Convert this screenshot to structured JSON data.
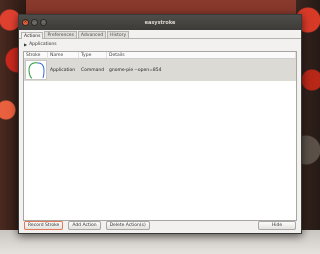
{
  "window": {
    "title": "easystroke",
    "buttons": [
      "×",
      "–",
      "□"
    ]
  },
  "tabs": [
    {
      "label": "Actions",
      "active": true
    },
    {
      "label": "Preferences",
      "active": false
    },
    {
      "label": "Advanced",
      "active": false
    },
    {
      "label": "History",
      "active": false
    }
  ],
  "expander": {
    "label": "Applications",
    "icon": "triangle-right-icon",
    "arrow_glyph": "▶"
  },
  "table": {
    "columns": [
      "Stroke",
      "Name",
      "Type",
      "Details"
    ],
    "rows": [
      {
        "stroke": "stroke-gesture-icon",
        "name": "Application",
        "type": "Command",
        "details": "gnome-pie --open=854"
      }
    ]
  },
  "buttons": {
    "record_stroke": "Record Stroke",
    "add_action": "Add Action",
    "delete_action": "Delete Action(s)",
    "hide": "Hide"
  },
  "colors": {
    "titlebar": "#3c3b37",
    "close_button": "#e7613b",
    "selected_row": "#dcdad5",
    "stroke_line": "#2a9a3a",
    "stroke_line_end": "#3a6ad8"
  }
}
